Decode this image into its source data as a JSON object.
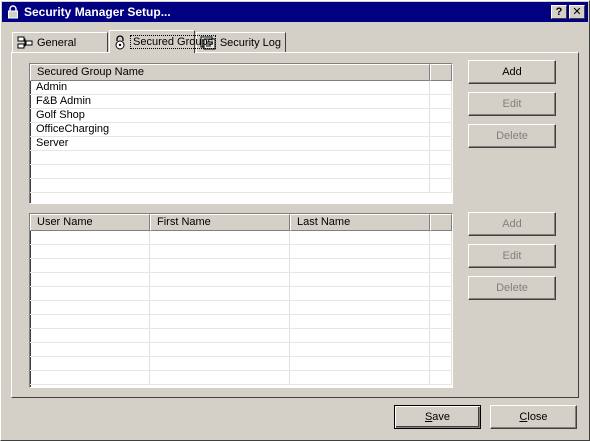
{
  "window": {
    "title": "Security Manager Setup...",
    "help_label": "?",
    "close_label": "✕"
  },
  "tabs": [
    {
      "label": "General",
      "icon": "tree-icon",
      "active": false
    },
    {
      "label": "Secured Groups",
      "icon": "lock-icon",
      "active": true
    },
    {
      "label": "Security Log",
      "icon": "log-icon",
      "active": false
    }
  ],
  "groups_list": {
    "header": "Secured Group Name",
    "items": [
      "Admin",
      "F&B Admin",
      "Golf Shop",
      "OfficeCharging",
      "Server"
    ]
  },
  "group_buttons": {
    "add": "Add",
    "edit": "Edit",
    "delete": "Delete"
  },
  "users_list": {
    "headers": [
      "User Name",
      "First Name",
      "Last Name"
    ],
    "rows": []
  },
  "user_buttons": {
    "add": "Add",
    "edit": "Edit",
    "delete": "Delete"
  },
  "footer": {
    "save_prefix": "",
    "save_hotkey": "S",
    "save_rest": "ave",
    "close_hotkey": "C",
    "close_rest": "lose"
  }
}
